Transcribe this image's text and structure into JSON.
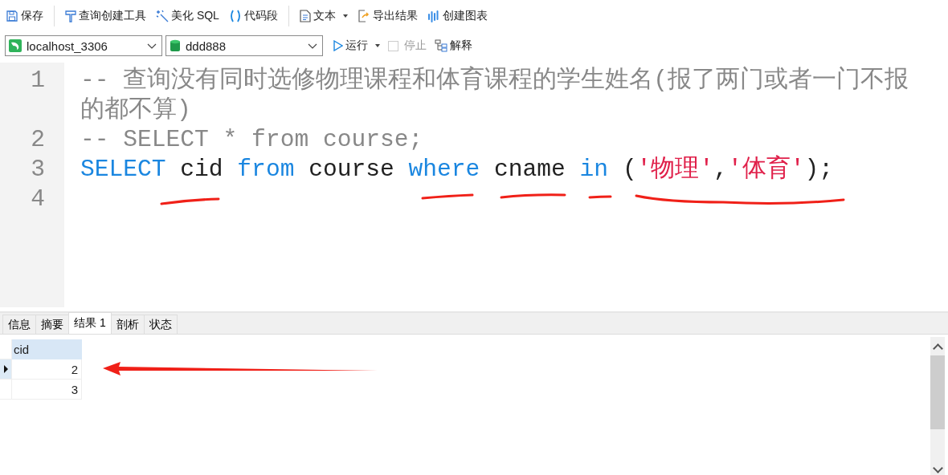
{
  "toolbar": [
    {
      "label": "保存",
      "dropdown": false
    },
    {
      "label": "查询创建工具",
      "dropdown": false
    },
    {
      "label": "美化 SQL",
      "dropdown": false
    },
    {
      "label": "代码段",
      "dropdown": false
    },
    {
      "label": "文本",
      "dropdown": true
    },
    {
      "label": "导出结果",
      "dropdown": false
    },
    {
      "label": "创建图表",
      "dropdown": false
    }
  ],
  "connection": {
    "value": "localhost_3306"
  },
  "database": {
    "value": "ddd888"
  },
  "run": {
    "label": "运行"
  },
  "stop": {
    "label": "停止",
    "disabled": true
  },
  "explain": {
    "label": "解释"
  },
  "editor": {
    "lines": [
      {
        "number": "1",
        "tokens": [
          {
            "text": "-- 查询没有同时选修物理课程和体育课程的学生姓名(报了两门或者一门不报的都不算)",
            "kind": "comment"
          }
        ]
      },
      {
        "number": "2",
        "tokens": [
          {
            "text": "-- SELECT * from course;",
            "kind": "comment"
          }
        ]
      },
      {
        "number": "3",
        "tokens": [
          {
            "text": "SELECT",
            "kind": "keyword"
          },
          {
            "text": " cid ",
            "kind": "plain"
          },
          {
            "text": "from",
            "kind": "keyword"
          },
          {
            "text": " course ",
            "kind": "plain"
          },
          {
            "text": "where",
            "kind": "keyword"
          },
          {
            "text": " cname ",
            "kind": "plain"
          },
          {
            "text": "in",
            "kind": "keyword"
          },
          {
            "text": " (",
            "kind": "plain"
          },
          {
            "text": "'物理'",
            "kind": "string"
          },
          {
            "text": ",",
            "kind": "plain"
          },
          {
            "text": "'体育'",
            "kind": "string"
          },
          {
            "text": ");",
            "kind": "plain"
          }
        ]
      },
      {
        "number": "4"
      }
    ]
  },
  "result_tabs": [
    {
      "label": "信息",
      "selected": false
    },
    {
      "label": "摘要",
      "selected": false
    },
    {
      "label": "结果 1",
      "selected": true
    },
    {
      "label": "剖析",
      "selected": false
    },
    {
      "label": "状态",
      "selected": false
    }
  ],
  "table": {
    "columns": [
      "cid"
    ],
    "rows": [
      {
        "cells": [
          "2"
        ],
        "selected": true
      },
      {
        "cells": [
          "3"
        ],
        "selected": false
      }
    ]
  }
}
